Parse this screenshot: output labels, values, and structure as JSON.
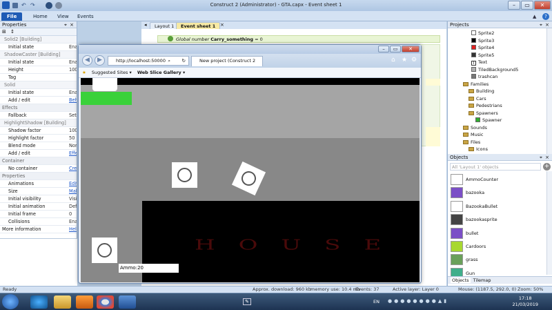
{
  "window": {
    "title": "Construct 2 (Administrator) - GTA.capx - Event sheet 1"
  },
  "ribbon": {
    "tabs": [
      {
        "label": "File"
      },
      {
        "label": "Home"
      },
      {
        "label": "View"
      },
      {
        "label": "Events"
      }
    ]
  },
  "properties": {
    "title": "Properties",
    "rows": [
      {
        "type": "sub",
        "key": "Solid2 [Building]",
        "value": ""
      },
      {
        "type": "row",
        "key": "Initial state",
        "value": "Ena"
      },
      {
        "type": "sub",
        "key": "ShadowCaster [Building]",
        "value": ""
      },
      {
        "type": "row",
        "key": "Initial state",
        "value": "Ena"
      },
      {
        "type": "row",
        "key": "Height",
        "value": "100"
      },
      {
        "type": "row",
        "key": "Tag",
        "value": ""
      },
      {
        "type": "sub",
        "key": "Solid",
        "value": ""
      },
      {
        "type": "row",
        "key": "Initial state",
        "value": "Ena"
      },
      {
        "type": "linkrow",
        "key": "Add / edit",
        "value": "Beh"
      },
      {
        "type": "grp",
        "key": "Effects",
        "value": ""
      },
      {
        "type": "row",
        "key": "Fallback",
        "value": "Set"
      },
      {
        "type": "sub",
        "key": "HighlightShadow [Building]",
        "value": ""
      },
      {
        "type": "row",
        "key": "Shadow factor",
        "value": "100"
      },
      {
        "type": "row",
        "key": "Highlight factor",
        "value": "50"
      },
      {
        "type": "row",
        "key": "Blend mode",
        "value": "Nor"
      },
      {
        "type": "linkrow",
        "key": "Add / edit",
        "value": "Effe"
      },
      {
        "type": "grp",
        "key": "Container",
        "value": ""
      },
      {
        "type": "linkrow",
        "key": "No container",
        "value": "Cre"
      },
      {
        "type": "grp",
        "key": "Properties",
        "value": ""
      },
      {
        "type": "linkrow",
        "key": "Animations",
        "value": "Edit"
      },
      {
        "type": "linkrow",
        "key": "Size",
        "value": "Mak"
      },
      {
        "type": "row",
        "key": "Initial visibility",
        "value": "Visi"
      },
      {
        "type": "row",
        "key": "Initial animation",
        "value": "Def"
      },
      {
        "type": "row",
        "key": "Initial frame",
        "value": "0"
      },
      {
        "type": "row",
        "key": "Collisions",
        "value": "Ena"
      },
      {
        "type": "toplink",
        "key": "More information",
        "value": "Hel"
      }
    ]
  },
  "editor_tabs": [
    {
      "label": "Layout 1"
    },
    {
      "label": "Event sheet 1"
    }
  ],
  "event_sheet": {
    "global_var": {
      "prefix": "Global number",
      "name": "Carry_something",
      "value": "= 0"
    }
  },
  "browser": {
    "address": "http://localhost:50000",
    "tab_title": "New project (Construct 2 pr...",
    "favorites": [
      {
        "label": "Suggested Sites"
      },
      {
        "label": "Web Slice Gallery"
      }
    ]
  },
  "game": {
    "ammo_label": "Ammo:20",
    "house_text": "HOUSE"
  },
  "projects": {
    "title": "Projects",
    "items": [
      {
        "label": "Sprite2",
        "kind": "sprite",
        "color": "#ffffff"
      },
      {
        "label": "Sprite3",
        "kind": "sprite",
        "color": "#000000"
      },
      {
        "label": "Sprite4",
        "kind": "sprite",
        "color": "#e02020"
      },
      {
        "label": "Sprite5",
        "kind": "sprite",
        "color": "#333333"
      },
      {
        "label": "Text",
        "kind": "text",
        "color": "#ffffff"
      },
      {
        "label": "TiledBackground5",
        "kind": "sprite",
        "color": "#b0b0b0"
      },
      {
        "label": "trashcan",
        "kind": "sprite",
        "color": "#777777"
      },
      {
        "label": "Families",
        "kind": "folder",
        "color": ""
      },
      {
        "label": "Building",
        "kind": "family",
        "color": ""
      },
      {
        "label": "Cars",
        "kind": "family",
        "color": ""
      },
      {
        "label": "Pedestrians",
        "kind": "family",
        "color": ""
      },
      {
        "label": "Spawners",
        "kind": "family",
        "color": ""
      },
      {
        "label": "Spawner",
        "kind": "sprite",
        "color": "#2fae2f"
      },
      {
        "label": "Sounds",
        "kind": "folder",
        "color": ""
      },
      {
        "label": "Music",
        "kind": "folder",
        "color": ""
      },
      {
        "label": "Files",
        "kind": "folder",
        "color": ""
      },
      {
        "label": "Icons",
        "kind": "folder",
        "color": ""
      }
    ]
  },
  "objects": {
    "title": "Objects",
    "filter_placeholder": "All 'Layout 1' objects",
    "items": [
      {
        "label": "AmmoCounter",
        "color": "#ffffff"
      },
      {
        "label": "bazooka",
        "color": "#7b4fc6"
      },
      {
        "label": "BazookaBullet",
        "color": "#ffffff"
      },
      {
        "label": "bazookasprite",
        "color": "#444444"
      },
      {
        "label": "bullet",
        "color": "#7b4fc6"
      },
      {
        "label": "Cardoors",
        "color": "#a8d830"
      },
      {
        "label": "grass",
        "color": "#6aa05a"
      },
      {
        "label": "Gun",
        "color": "#3fae8a"
      }
    ],
    "tabs": [
      {
        "label": "Objects"
      },
      {
        "label": "Tilemap"
      }
    ]
  },
  "status": {
    "ready": "Ready",
    "download": "Approx. download: 960 kb",
    "memory": "memory use: 10.4 mb",
    "events": "Events: 37",
    "layer": "Active layer: Layer 0",
    "mouse": "Mouse: (1187.5, 292.0, 0)",
    "zoom": "Zoom: 50%"
  },
  "taskbar": {
    "lang": "EN",
    "time": "17:18",
    "date": "21/03/2019"
  }
}
